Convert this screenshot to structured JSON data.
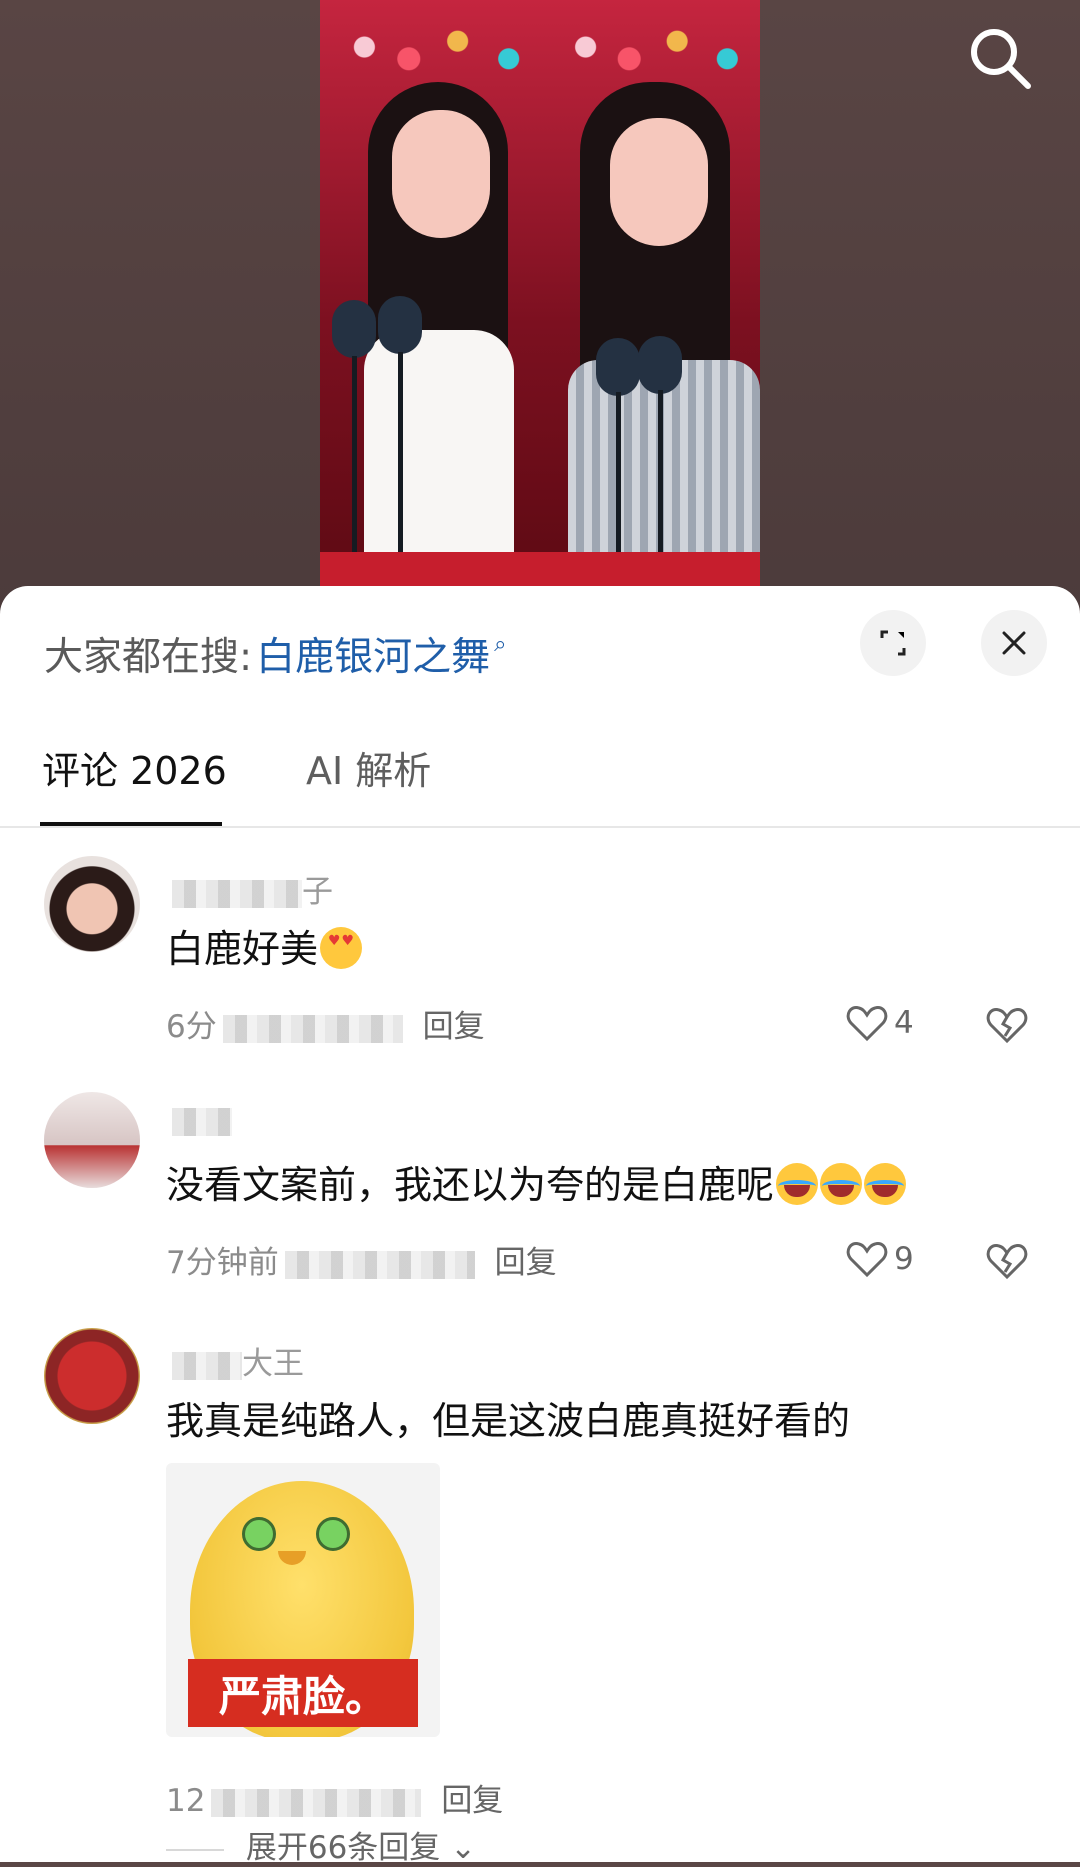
{
  "header": {
    "search_label": "大家都在搜:",
    "search_query": "白鹿银河之舞",
    "search_icon": "magnifier-icon"
  },
  "video": {
    "icons": {
      "search": "search-icon"
    }
  },
  "sheet": {
    "expand_icon": "expand-icon",
    "close_icon": "close-icon",
    "tabs": [
      {
        "label": "评论 2026",
        "active": true
      },
      {
        "label": "AI 解析",
        "active": false
      }
    ]
  },
  "comments": [
    {
      "name_visible": "子",
      "text": "白鹿好美",
      "emoji": "heart-eyes",
      "time_visible": "6分",
      "reply": "回复",
      "likes": "4"
    },
    {
      "name_visible": "",
      "text": "没看文案前，我还以为夸的是白鹿呢",
      "emoji": "laugh",
      "time_visible": "7分钟前",
      "reply": "回复",
      "likes": "9"
    },
    {
      "name_visible": "大王",
      "text": "我真是纯路人，但是这波白鹿真挺好看的",
      "sticker_text": "严肃脸。",
      "time_visible": "12",
      "reply": "回复"
    }
  ],
  "expand_replies": "展开66条回复",
  "colors": {
    "accent_blue": "#1f5ea9",
    "sticker_red": "#d62d20"
  }
}
